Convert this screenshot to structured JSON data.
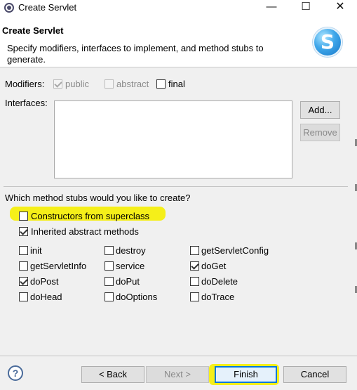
{
  "window": {
    "title": "Create Servlet",
    "minimize_icon": "—",
    "maximize_icon": "☐",
    "close_icon": "✕"
  },
  "header": {
    "title": "Create Servlet",
    "description": "Specify modifiers, interfaces to implement, and method stubs to generate.",
    "logo_letter": "S"
  },
  "modifiers": {
    "label": "Modifiers:",
    "public": {
      "label": "public",
      "checked": true,
      "enabled": false
    },
    "abstract": {
      "label": "abstract",
      "checked": false,
      "enabled": false
    },
    "final": {
      "label": "final",
      "checked": false,
      "enabled": true
    }
  },
  "interfaces": {
    "label": "Interfaces:",
    "add_label": "Add...",
    "remove_label": "Remove",
    "items": []
  },
  "stubs": {
    "question": "Which method stubs would you like to create?",
    "constructors": {
      "label": "Constructors from superclass",
      "checked": false
    },
    "inherited": {
      "label": "Inherited abstract methods",
      "checked": true
    },
    "methods": [
      {
        "label": "init",
        "checked": false
      },
      {
        "label": "destroy",
        "checked": false
      },
      {
        "label": "getServletConfig",
        "checked": false
      },
      {
        "label": "getServletInfo",
        "checked": false
      },
      {
        "label": "service",
        "checked": false
      },
      {
        "label": "doGet",
        "checked": true
      },
      {
        "label": "doPost",
        "checked": true
      },
      {
        "label": "doPut",
        "checked": false
      },
      {
        "label": "doDelete",
        "checked": false
      },
      {
        "label": "doHead",
        "checked": false
      },
      {
        "label": "doOptions",
        "checked": false
      },
      {
        "label": "doTrace",
        "checked": false
      }
    ]
  },
  "footer": {
    "help_icon": "?",
    "back_label": "< Back",
    "next_label": "Next >",
    "finish_label": "Finish",
    "cancel_label": "Cancel"
  },
  "colors": {
    "highlight": "#f5ef19",
    "focus_border": "#0078d7"
  }
}
